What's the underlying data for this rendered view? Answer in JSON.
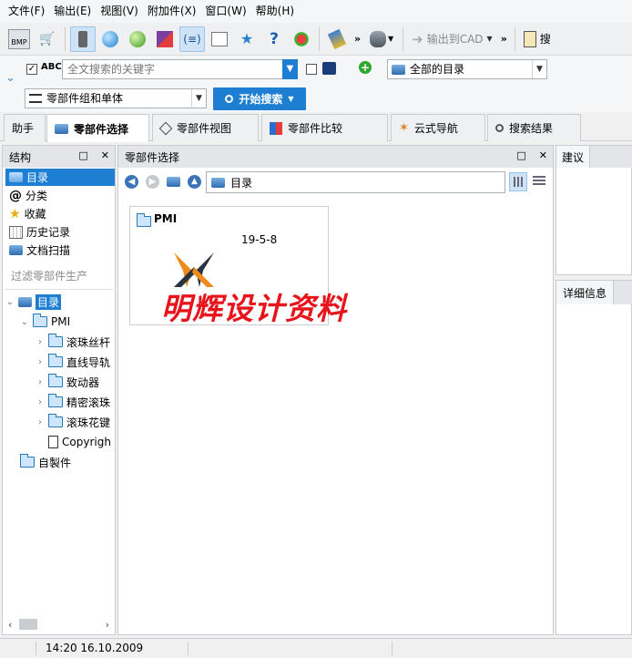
{
  "menu": [
    "文件(F)",
    "输出(E)",
    "视图(V)",
    "附加件(X)",
    "窗口(W)",
    "帮助(H)"
  ],
  "toolbar": {
    "bmp_label": "BMP",
    "export_cad": "输出到CAD",
    "cut_label": "搜"
  },
  "search": {
    "abc_label": "ABC",
    "placeholder": "全文搜索的关键字",
    "scope": "全部的目录",
    "mode": "零部件组和单体",
    "start_button": "开始搜索"
  },
  "tabs": [
    "助手",
    "零部件选择",
    "零部件视图",
    "零部件比较",
    "云式导航",
    "搜索结果"
  ],
  "structure": {
    "title": "结构",
    "items": [
      "目录",
      "分类",
      "收藏",
      "历史记录",
      "文档扫描"
    ],
    "filter_placeholder": "过滤零部件生产",
    "tree": {
      "root": "目录",
      "pmi": "PMI",
      "children": [
        "滚珠丝杆",
        "直线导轨",
        "致动器",
        "精密滚珠",
        "滚珠花键"
      ],
      "copyright": "Copyrigh",
      "self_made": "自製件"
    }
  },
  "center": {
    "title": "零部件选择",
    "path": "目录",
    "card": {
      "title": "PMI",
      "date": "19-5-8",
      "watermark": "明辉设计资料"
    }
  },
  "right": {
    "suggest": "建议",
    "details": "详细信息"
  },
  "status": {
    "datetime": "14:20 16.10.2009"
  },
  "colors": {
    "accent": "#1e7fd2",
    "watermark": "#e8141c",
    "logo_orange": "#f08a1c"
  }
}
